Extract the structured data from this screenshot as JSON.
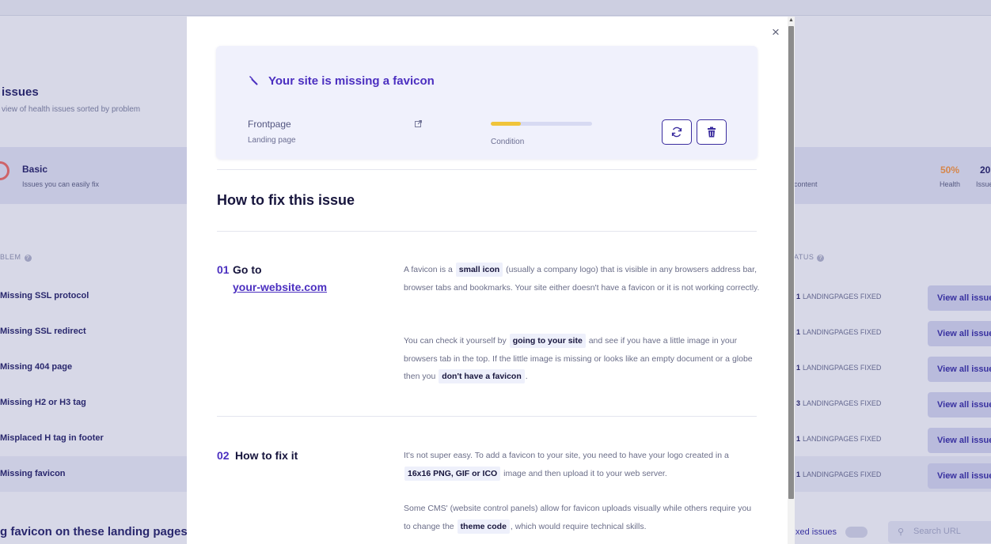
{
  "background": {
    "page_title": "issues",
    "page_subtitle": "view of health issues sorted by problem",
    "summary": {
      "basic_title": "Basic",
      "basic_sub": "Issues you can easily fix",
      "content_label": "content",
      "health_value": "50%",
      "health_label": "Health",
      "issues_value": "20",
      "issues_label": "Issues"
    },
    "table": {
      "col_problem": "BLEM",
      "col_status": "ATUS",
      "fixed_suffix": "LANDINGPAGES FIXED",
      "button_label": "View all issues",
      "rows": [
        {
          "name": "Missing SSL protocol",
          "count": "1"
        },
        {
          "name": "Missing SSL redirect",
          "count": "1"
        },
        {
          "name": "Missing 404 page",
          "count": "1"
        },
        {
          "name": "Missing H2 or H3 tag",
          "count": "3"
        },
        {
          "name": "Misplaced H tag in footer",
          "count": "1"
        },
        {
          "name": "Missing favicon",
          "count": "1"
        }
      ]
    },
    "bottom_title": "g favicon on these landing pages",
    "toggle_label": "xed issues",
    "search_placeholder": "Search URL"
  },
  "modal": {
    "close_glyph": "×",
    "card": {
      "title": "Your site is missing a favicon",
      "page_name": "Frontpage",
      "page_type": "Landing page",
      "condition_label": "Condition",
      "condition_level": 0.3
    },
    "section_title": "How to fix this issue",
    "steps": [
      {
        "num": "01",
        "title": "Go to",
        "link": "your-website.com",
        "p1": {
          "a": "A favicon is a",
          "hl1": "small icon",
          "b": "(usually a company logo) that is visible in any browsers address bar, browser tabs and bookmarks. Your site either doesn't have a favicon or it is not working correctly."
        },
        "p2": {
          "a": "You can check it yourself by",
          "hl1": "going to your site",
          "b": "and see if you have a little image in your browsers tab in the top. If the little image is missing or looks like an empty document or a globe then you",
          "hl2": "don't have a favicon",
          "c": "."
        }
      },
      {
        "num": "02",
        "title": "How to fix it",
        "p1": {
          "a": "It's not super easy. To add a favicon to your site, you need to have your logo created in a",
          "hl1": "16x16 PNG, GIF or ICO",
          "b": "image and then upload it to your web server."
        },
        "p2": {
          "a": "Some CMS' (website control panels) allow for favicon uploads visually while others require you to change the",
          "hl1": "theme code",
          "b": ", which would require technical skills."
        }
      }
    ]
  },
  "colors": {
    "accent": "#4b2fc0",
    "progress_fill": "#f0c43a",
    "card_bg": "#f0f1fc"
  }
}
